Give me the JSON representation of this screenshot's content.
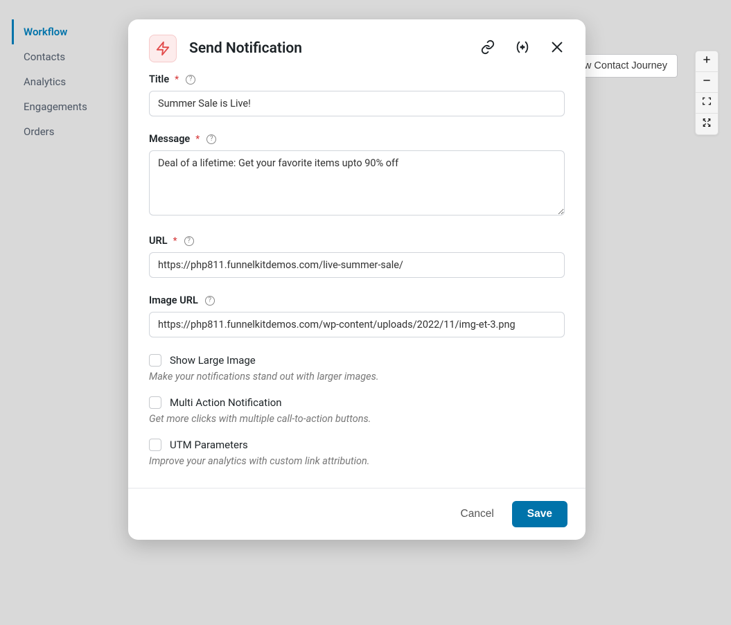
{
  "sidebar": {
    "items": [
      {
        "label": "Workflow",
        "active": true
      },
      {
        "label": "Contacts",
        "active": false
      },
      {
        "label": "Analytics",
        "active": false
      },
      {
        "label": "Engagements",
        "active": false
      },
      {
        "label": "Orders",
        "active": false
      }
    ]
  },
  "background": {
    "preview_button": "Preview Contact Journey"
  },
  "zoom": {
    "in_icon": "plus-icon",
    "out_icon": "minus-icon",
    "fit_icon": "fit-icon",
    "fullscreen_icon": "fullscreen-icon"
  },
  "modal": {
    "title": "Send Notification",
    "icon": "lightning-icon",
    "fields": {
      "title": {
        "label": "Title",
        "required": true,
        "value": "Summer Sale is Live!"
      },
      "message": {
        "label": "Message",
        "required": true,
        "value": "Deal of a lifetime: Get your favorite items upto 90% off"
      },
      "url": {
        "label": "URL",
        "required": true,
        "value": "https://php811.funnelkitdemos.com/live-summer-sale/"
      },
      "image_url": {
        "label": "Image URL",
        "required": false,
        "value": "https://php811.funnelkitdemos.com/wp-content/uploads/2022/11/img-et-3.png"
      }
    },
    "checkboxes": {
      "large_image": {
        "label": "Show Large Image",
        "desc": "Make your notifications stand out with larger images.",
        "checked": false
      },
      "multi_action": {
        "label": "Multi Action Notification",
        "desc": "Get more clicks with multiple call-to-action buttons.",
        "checked": false
      },
      "utm": {
        "label": "UTM Parameters",
        "desc": "Improve your analytics with custom link attribution.",
        "checked": false
      }
    },
    "footer": {
      "cancel": "Cancel",
      "save": "Save"
    }
  }
}
